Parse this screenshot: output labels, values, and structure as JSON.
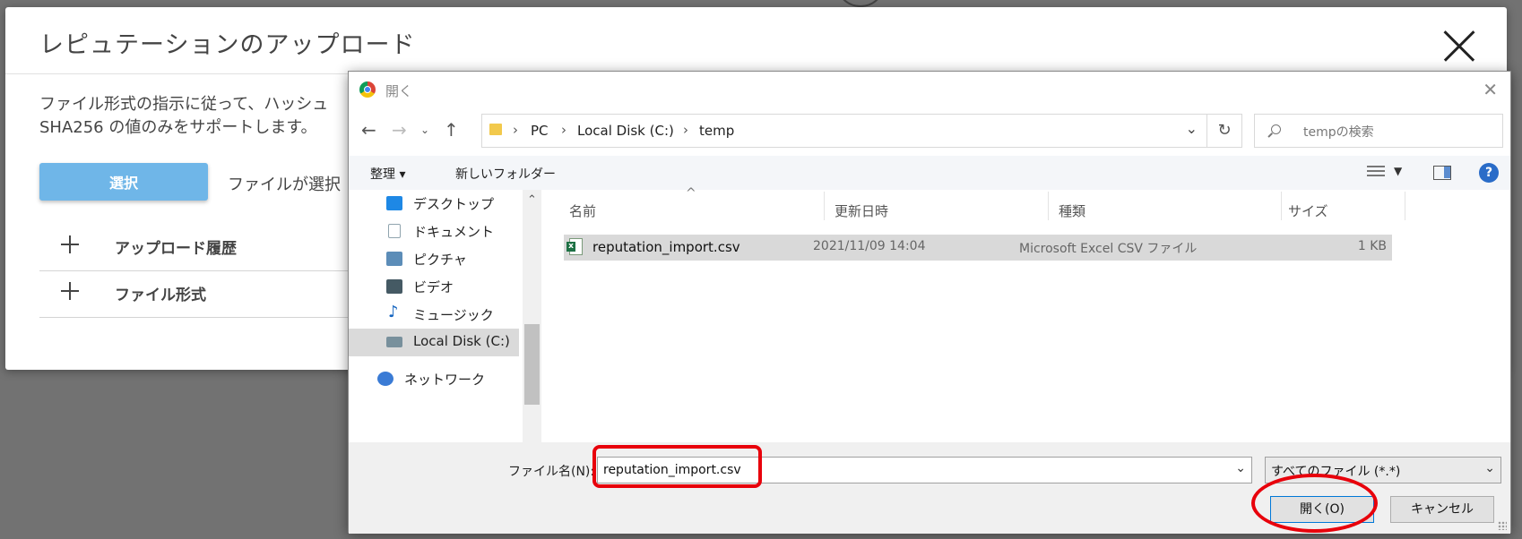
{
  "modal": {
    "title": "レピュテーションのアップロード",
    "description_line1": "ファイル形式の指示に従って、ハッシュ",
    "description_line2": "SHA256 の値のみをサポートします。",
    "select_button": "選択",
    "no_file_text": "ファイルが選択",
    "accordion": [
      {
        "label": "アップロード履歴"
      },
      {
        "label": "ファイル形式"
      }
    ]
  },
  "dialog": {
    "title": "開く",
    "breadcrumb": [
      "PC",
      "Local Disk (C:)",
      "temp"
    ],
    "search_placeholder": "tempの検索",
    "toolbar": {
      "organize": "整理 ▾",
      "new_folder": "新しいフォルダー"
    },
    "sidebar": [
      {
        "label": "デスクトップ",
        "icon": "desktop-icon",
        "color": "#1e88e5"
      },
      {
        "label": "ドキュメント",
        "icon": "document-icon",
        "color": "#90a4ae"
      },
      {
        "label": "ピクチャ",
        "icon": "picture-icon",
        "color": "#5c8db8"
      },
      {
        "label": "ビデオ",
        "icon": "video-icon",
        "color": "#455a64"
      },
      {
        "label": "ミュージック",
        "icon": "music-icon",
        "color": "#1565c0"
      },
      {
        "label": "Local Disk (C:)",
        "icon": "disk-icon",
        "color": "#78909c"
      },
      {
        "label": "ネットワーク",
        "icon": "network-icon",
        "color": "#3a7bd5"
      }
    ],
    "columns": [
      "名前",
      "更新日時",
      "種類",
      "サイズ"
    ],
    "files": [
      {
        "name": "reputation_import.csv",
        "modified": "2021/11/09 14:04",
        "type": "Microsoft Excel CSV ファイル",
        "size": "1 KB"
      }
    ],
    "filename_label": "ファイル名(N):",
    "filename_value": "reputation_import.csv",
    "filetype_value": "すべてのファイル (*.*)",
    "open_button": "開く(O)",
    "cancel_button": "キャンセル"
  },
  "colors": {
    "highlight": "#e8000b",
    "select_button": "#6fb6e8"
  }
}
